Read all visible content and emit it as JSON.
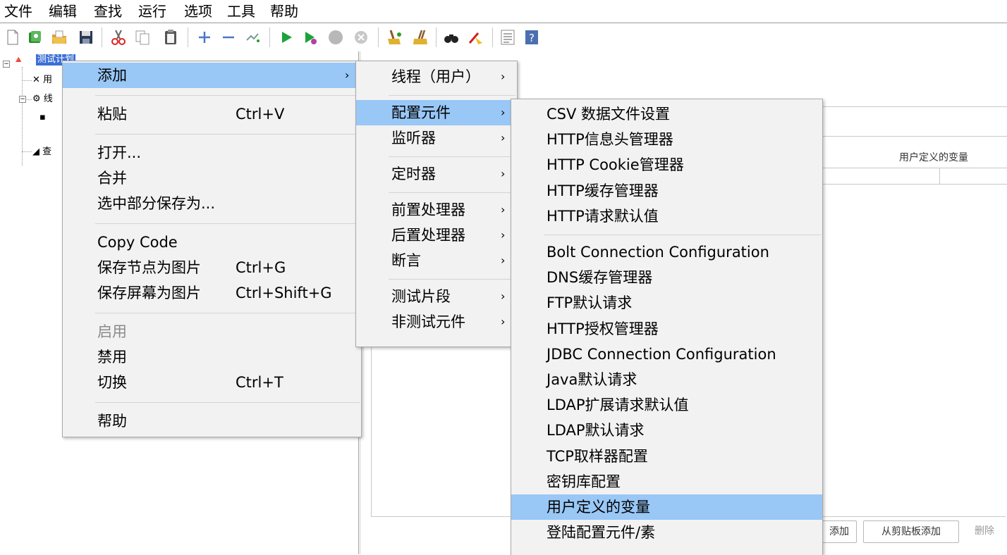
{
  "menubar": [
    "文件",
    "编辑",
    "查找",
    "运行",
    "选项",
    "工具",
    "帮助"
  ],
  "toolbar": [
    "new-icon",
    "templates-icon",
    "open-icon",
    "save-icon",
    "cut-icon",
    "copy-icon",
    "paste-icon",
    "expand-icon",
    "collapse-icon",
    "toggle-icon",
    "start-icon",
    "start-no-pause-icon",
    "stop-icon",
    "shutdown-icon",
    "clear-icon",
    "clear-all-icon",
    "search-icon",
    "reset-search-icon",
    "function-helper-icon",
    "help-icon"
  ],
  "tree": {
    "root": "测试计划",
    "n1": "用",
    "n2": "线",
    "n4": "查"
  },
  "right_panel": {
    "column_header": "用户定义的变量",
    "buttons": {
      "add": "添加",
      "add_clipboard": "从剪贴板添加",
      "delete": "删除"
    }
  },
  "context_menu": [
    {
      "label": "添加",
      "submenu": true,
      "highlight": true
    },
    {
      "sep": true
    },
    {
      "label": "粘贴",
      "shortcut": "Ctrl+V"
    },
    {
      "sep": true
    },
    {
      "label": "打开..."
    },
    {
      "label": "合并"
    },
    {
      "label": "选中部分保存为..."
    },
    {
      "sep": true
    },
    {
      "label": "Copy Code"
    },
    {
      "label": "保存节点为图片",
      "shortcut": "Ctrl+G"
    },
    {
      "label": "保存屏幕为图片",
      "shortcut": "Ctrl+Shift+G"
    },
    {
      "sep": true
    },
    {
      "label": "启用",
      "disabled": true
    },
    {
      "label": "禁用"
    },
    {
      "label": "切换",
      "shortcut": "Ctrl+T"
    },
    {
      "sep": true
    },
    {
      "label": "帮助"
    }
  ],
  "add_menu": [
    {
      "label": "线程（用户）",
      "submenu": true
    },
    {
      "sep": true
    },
    {
      "label": "配置元件",
      "submenu": true,
      "highlight": true
    },
    {
      "label": "监听器",
      "submenu": true
    },
    {
      "sep": true
    },
    {
      "label": "定时器",
      "submenu": true
    },
    {
      "sep": true
    },
    {
      "label": "前置处理器",
      "submenu": true
    },
    {
      "label": "后置处理器",
      "submenu": true
    },
    {
      "label": "断言",
      "submenu": true
    },
    {
      "sep": true
    },
    {
      "label": "测试片段",
      "submenu": true
    },
    {
      "label": "非测试元件",
      "submenu": true
    }
  ],
  "config_menu": [
    {
      "label": "CSV 数据文件设置"
    },
    {
      "label": "HTTP信息头管理器"
    },
    {
      "label": "HTTP Cookie管理器"
    },
    {
      "label": "HTTP缓存管理器"
    },
    {
      "label": "HTTP请求默认值"
    },
    {
      "sep": true
    },
    {
      "label": "Bolt Connection Configuration"
    },
    {
      "label": "DNS缓存管理器"
    },
    {
      "label": "FTP默认请求"
    },
    {
      "label": "HTTP授权管理器"
    },
    {
      "label": "JDBC Connection Configuration"
    },
    {
      "label": "Java默认请求"
    },
    {
      "label": "LDAP扩展请求默认值"
    },
    {
      "label": "LDAP默认请求"
    },
    {
      "label": "TCP取样器配置"
    },
    {
      "label": "密钥库配置"
    },
    {
      "label": "用户定义的变量",
      "highlight": true
    },
    {
      "label": "登陆配置元件/素"
    }
  ],
  "colors": {
    "highlight": "#99c7f6",
    "menu_bg": "#f2f2f2",
    "tree_selection": "#3b6fd6"
  },
  "arrow": "›"
}
